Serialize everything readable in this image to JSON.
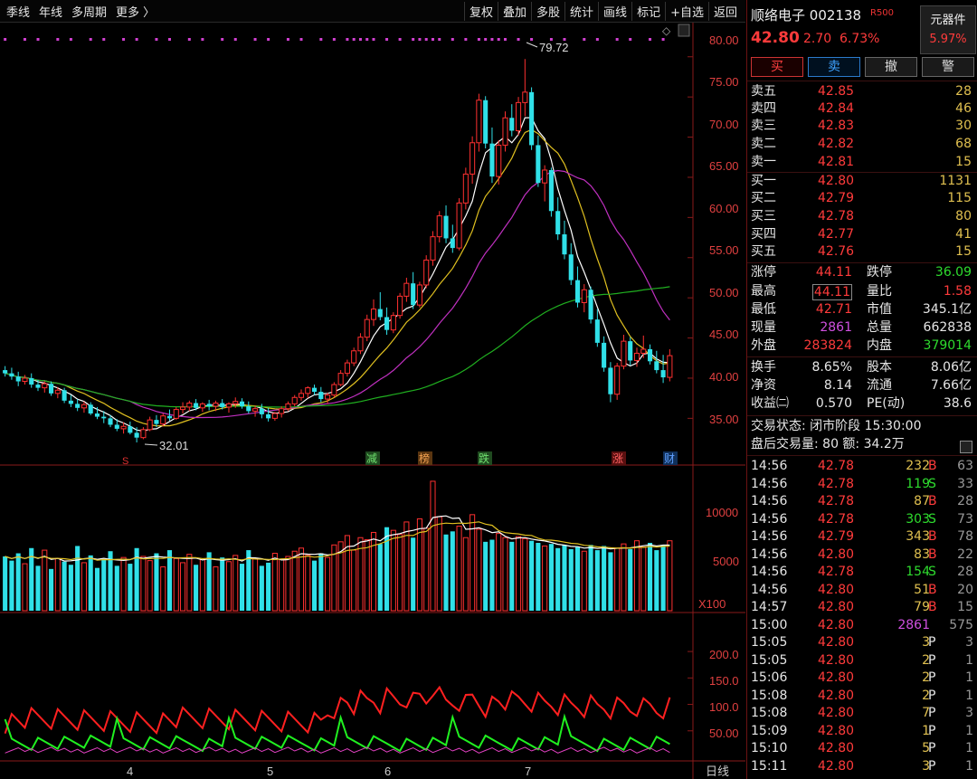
{
  "toolbar": {
    "left": [
      "季线",
      "年线",
      "多周期",
      "更多 〉"
    ],
    "right": [
      "复权",
      "叠加",
      "多股",
      "统计",
      "画线",
      "标记",
      "+自选",
      "返回"
    ]
  },
  "price_axis": [
    "80.00",
    "75.00",
    "70.00",
    "65.00",
    "60.00",
    "55.00",
    "50.00",
    "45.00",
    "40.00",
    "35.00"
  ],
  "volume_axis": [
    "10000",
    "5000"
  ],
  "volume_unit": "X100",
  "indicator_axis": [
    "200.0",
    "150.0",
    "100.0",
    "50.00"
  ],
  "x_axis": [
    "4",
    "5",
    "6",
    "7"
  ],
  "period_label": "日线",
  "annotations": {
    "high": "79.72",
    "low": "32.01",
    "events": [
      {
        "label": "减",
        "color": "#2a8a2a"
      },
      {
        "label": "榜",
        "color": "#b06a20"
      },
      {
        "label": "跌",
        "color": "#2a8a2a"
      },
      {
        "label": "涨",
        "color": "#b02020"
      },
      {
        "label": "财",
        "color": "#2060b0"
      }
    ],
    "marker_s": "S"
  },
  "stock": {
    "name": "顺络电子",
    "code": "002138",
    "badge": "R500",
    "price": "42.80",
    "change": "2.70",
    "change_pct": "6.73%",
    "sector_name": "元器件",
    "sector_pct": "5.97%"
  },
  "buttons": {
    "buy": "买",
    "sell": "卖",
    "cancel": "撤",
    "alert": "警"
  },
  "asks": [
    {
      "label": "卖五",
      "price": "42.85",
      "vol": "28"
    },
    {
      "label": "卖四",
      "price": "42.84",
      "vol": "46"
    },
    {
      "label": "卖三",
      "price": "42.83",
      "vol": "30"
    },
    {
      "label": "卖二",
      "price": "42.82",
      "vol": "68"
    },
    {
      "label": "卖一",
      "price": "42.81",
      "vol": "15"
    }
  ],
  "bids": [
    {
      "label": "买一",
      "price": "42.80",
      "vol": "1131"
    },
    {
      "label": "买二",
      "price": "42.79",
      "vol": "115"
    },
    {
      "label": "买三",
      "price": "42.78",
      "vol": "80"
    },
    {
      "label": "买四",
      "price": "42.77",
      "vol": "41"
    },
    {
      "label": "买五",
      "price": "42.76",
      "vol": "15"
    }
  ],
  "stats1": {
    "limit_up_l": "涨停",
    "limit_up": "44.11",
    "limit_dn_l": "跌停",
    "limit_dn": "36.09",
    "high_l": "最高",
    "high": "44.11",
    "vol_ratio_l": "量比",
    "vol_ratio": "1.58",
    "low_l": "最低",
    "low": "42.71",
    "mcap_l": "市值",
    "mcap": "345.1亿",
    "cur_vol_l": "现量",
    "cur_vol": "2861",
    "total_vol_l": "总量",
    "total_vol": "662838",
    "outer_l": "外盘",
    "outer": "283824",
    "inner_l": "内盘",
    "inner": "379014"
  },
  "stats2": {
    "turnover_l": "换手",
    "turnover": "8.65%",
    "equity_l": "股本",
    "equity": "8.06亿",
    "nav_l": "净资",
    "nav": "8.14",
    "float_l": "流通",
    "float": "7.66亿",
    "eps_l": "收益㈡",
    "eps": "0.570",
    "pe_l": "PE(动)",
    "pe": "38.6"
  },
  "status": {
    "line1": "交易状态: 闭市阶段 15:30:00",
    "line2": "盘后交易量: 80  额: 34.2万"
  },
  "ticks": [
    {
      "t": "14:56",
      "p": "42.78",
      "v": "232",
      "s": "B",
      "n": "63"
    },
    {
      "t": "14:56",
      "p": "42.78",
      "v": "119",
      "s": "S",
      "n": "33"
    },
    {
      "t": "14:56",
      "p": "42.78",
      "v": "87",
      "s": "B",
      "n": "28"
    },
    {
      "t": "14:56",
      "p": "42.78",
      "v": "303",
      "s": "S",
      "n": "73"
    },
    {
      "t": "14:56",
      "p": "42.79",
      "v": "343",
      "s": "B",
      "n": "78"
    },
    {
      "t": "14:56",
      "p": "42.80",
      "v": "83",
      "s": "B",
      "n": "22"
    },
    {
      "t": "14:56",
      "p": "42.78",
      "v": "154",
      "s": "S",
      "n": "28"
    },
    {
      "t": "14:56",
      "p": "42.80",
      "v": "51",
      "s": "B",
      "n": "20"
    },
    {
      "t": "14:57",
      "p": "42.80",
      "v": "79",
      "s": "B",
      "n": "15"
    },
    {
      "t": "15:00",
      "p": "42.80",
      "v": "2861",
      "s": "",
      "n": "575"
    },
    {
      "t": "15:05",
      "p": "42.80",
      "v": "3",
      "s": "P",
      "n": "3"
    },
    {
      "t": "15:05",
      "p": "42.80",
      "v": "2",
      "s": "P",
      "n": "1"
    },
    {
      "t": "15:06",
      "p": "42.80",
      "v": "2",
      "s": "P",
      "n": "1"
    },
    {
      "t": "15:08",
      "p": "42.80",
      "v": "2",
      "s": "P",
      "n": "1"
    },
    {
      "t": "15:08",
      "p": "42.80",
      "v": "7",
      "s": "P",
      "n": "3"
    },
    {
      "t": "15:09",
      "p": "42.80",
      "v": "1",
      "s": "P",
      "n": "1"
    },
    {
      "t": "15:10",
      "p": "42.80",
      "v": "5",
      "s": "P",
      "n": "1"
    },
    {
      "t": "15:11",
      "p": "42.80",
      "v": "3",
      "s": "P",
      "n": "1"
    }
  ],
  "chart_data": {
    "type": "candlestick",
    "ylim": [
      32,
      82
    ],
    "x_ticks": [
      "4",
      "5",
      "6",
      "7"
    ],
    "ohlc": [
      [
        41.0,
        41.5,
        40.2,
        40.6
      ],
      [
        40.6,
        41.3,
        39.8,
        40.2
      ],
      [
        40.2,
        40.8,
        39.0,
        39.6
      ],
      [
        39.6,
        40.4,
        39.2,
        40.0
      ],
      [
        40.0,
        40.6,
        38.8,
        39.2
      ],
      [
        39.2,
        39.8,
        38.4,
        38.8
      ],
      [
        38.8,
        39.6,
        38.2,
        39.3
      ],
      [
        39.3,
        39.6,
        37.8,
        38.1
      ],
      [
        38.1,
        38.9,
        37.5,
        38.5
      ],
      [
        38.5,
        38.8,
        36.9,
        37.2
      ],
      [
        37.2,
        37.9,
        36.4,
        36.8
      ],
      [
        36.8,
        37.4,
        35.9,
        36.3
      ],
      [
        36.3,
        37.1,
        35.7,
        36.7
      ],
      [
        36.7,
        37.0,
        35.4,
        35.6
      ],
      [
        35.6,
        36.4,
        34.9,
        35.2
      ],
      [
        35.2,
        35.9,
        34.4,
        35.0
      ],
      [
        35.0,
        35.4,
        33.9,
        34.2
      ],
      [
        34.2,
        34.9,
        33.4,
        33.7
      ],
      [
        33.7,
        34.5,
        33.1,
        34.0
      ],
      [
        34.0,
        34.6,
        33.0,
        33.2
      ],
      [
        33.2,
        33.9,
        32.0,
        32.6
      ],
      [
        32.6,
        33.9,
        32.4,
        33.6
      ],
      [
        33.6,
        35.2,
        33.4,
        34.8
      ],
      [
        34.8,
        35.4,
        33.9,
        34.3
      ],
      [
        34.3,
        35.6,
        34.0,
        35.3
      ],
      [
        35.3,
        36.1,
        34.7,
        35.0
      ],
      [
        35.0,
        36.4,
        34.8,
        36.1
      ],
      [
        36.1,
        37.0,
        35.6,
        36.4
      ],
      [
        36.4,
        37.2,
        35.9,
        36.9
      ],
      [
        36.9,
        37.4,
        36.0,
        36.3
      ],
      [
        36.3,
        37.0,
        35.8,
        36.8
      ],
      [
        36.8,
        37.3,
        36.0,
        36.5
      ],
      [
        36.5,
        37.2,
        35.9,
        36.9
      ],
      [
        36.9,
        37.4,
        36.1,
        36.4
      ],
      [
        36.4,
        37.0,
        35.7,
        36.8
      ],
      [
        36.8,
        37.6,
        36.3,
        37.1
      ],
      [
        37.1,
        37.5,
        36.2,
        36.5
      ],
      [
        36.5,
        37.1,
        35.6,
        35.9
      ],
      [
        35.9,
        36.6,
        35.2,
        36.2
      ],
      [
        36.2,
        36.8,
        35.0,
        35.5
      ],
      [
        35.5,
        36.3,
        34.6,
        35.0
      ],
      [
        35.0,
        35.8,
        34.7,
        35.6
      ],
      [
        35.6,
        36.5,
        35.1,
        36.2
      ],
      [
        36.2,
        37.1,
        35.9,
        36.8
      ],
      [
        36.8,
        37.9,
        36.5,
        37.6
      ],
      [
        37.6,
        38.6,
        37.2,
        38.1
      ],
      [
        38.1,
        39.0,
        37.5,
        38.8
      ],
      [
        38.8,
        39.2,
        37.9,
        38.3
      ],
      [
        38.3,
        38.9,
        37.0,
        37.4
      ],
      [
        37.4,
        38.2,
        36.8,
        37.9
      ],
      [
        37.9,
        39.5,
        37.6,
        39.2
      ],
      [
        39.2,
        41.0,
        39.0,
        40.6
      ],
      [
        40.6,
        42.3,
        40.2,
        41.9
      ],
      [
        41.9,
        43.8,
        41.5,
        43.4
      ],
      [
        43.4,
        45.6,
        43.0,
        45.1
      ],
      [
        45.1,
        47.9,
        44.6,
        47.3
      ],
      [
        47.3,
        49.8,
        46.5,
        48.6
      ],
      [
        48.6,
        50.7,
        47.2,
        47.6
      ],
      [
        47.6,
        48.8,
        45.4,
        46.0
      ],
      [
        46.0,
        48.2,
        45.6,
        47.8
      ],
      [
        47.8,
        50.6,
        47.4,
        50.2
      ],
      [
        50.2,
        52.5,
        49.5,
        51.8
      ],
      [
        51.8,
        53.2,
        48.6,
        49.1
      ],
      [
        49.1,
        52.0,
        48.8,
        51.6
      ],
      [
        51.6,
        55.3,
        51.2,
        54.7
      ],
      [
        54.7,
        58.3,
        54.0,
        57.6
      ],
      [
        57.6,
        60.8,
        56.9,
        60.2
      ],
      [
        60.2,
        61.5,
        56.8,
        57.4
      ],
      [
        57.4,
        59.1,
        55.6,
        56.2
      ],
      [
        56.2,
        62.4,
        55.9,
        61.8
      ],
      [
        61.8,
        66.2,
        61.0,
        65.4
      ],
      [
        65.4,
        70.1,
        64.2,
        69.3
      ],
      [
        69.3,
        75.4,
        68.2,
        74.6
      ],
      [
        74.6,
        75.1,
        68.6,
        69.2
      ],
      [
        69.2,
        71.2,
        64.3,
        65.1
      ],
      [
        65.1,
        69.6,
        64.1,
        69.0
      ],
      [
        69.0,
        73.2,
        68.2,
        72.4
      ],
      [
        72.4,
        74.1,
        70.1,
        70.8
      ],
      [
        70.8,
        75.0,
        70.2,
        74.3
      ],
      [
        74.3,
        79.72,
        72.6,
        75.6
      ],
      [
        75.6,
        76.2,
        68.4,
        69.0
      ],
      [
        69.0,
        70.2,
        63.8,
        64.3
      ],
      [
        64.3,
        66.5,
        62.0,
        65.9
      ],
      [
        65.9,
        66.2,
        60.1,
        60.8
      ],
      [
        60.8,
        62.5,
        57.2,
        57.9
      ],
      [
        57.9,
        59.6,
        54.8,
        55.4
      ],
      [
        55.4,
        56.8,
        51.6,
        52.2
      ],
      [
        52.2,
        53.9,
        48.8,
        49.4
      ],
      [
        49.4,
        51.7,
        48.2,
        51.0
      ],
      [
        51.0,
        51.4,
        46.8,
        47.3
      ],
      [
        47.3,
        48.6,
        43.9,
        44.4
      ],
      [
        44.4,
        45.2,
        40.8,
        41.3
      ],
      [
        41.3,
        42.0,
        37.0,
        38.0
      ],
      [
        38.0,
        41.9,
        37.3,
        41.5
      ],
      [
        41.5,
        45.4,
        41.1,
        44.6
      ],
      [
        44.6,
        45.1,
        41.6,
        42.2
      ],
      [
        42.2,
        43.8,
        41.4,
        43.1
      ],
      [
        43.1,
        45.3,
        42.5,
        43.6
      ],
      [
        43.6,
        44.2,
        41.7,
        42.1
      ],
      [
        42.1,
        43.4,
        40.6,
        41.0
      ],
      [
        41.0,
        42.9,
        39.4,
        40.1
      ],
      [
        40.1,
        43.6,
        39.6,
        42.8
      ]
    ],
    "ma_series": [
      {
        "color": "#ffffff",
        "period": 5
      },
      {
        "color": "#e0c020",
        "period": 10
      },
      {
        "color": "#c030c0",
        "period": 20
      },
      {
        "color": "#20b020",
        "period": 60
      }
    ],
    "volume": [
      52,
      48,
      55,
      45,
      60,
      43,
      58,
      40,
      50,
      47,
      44,
      62,
      46,
      53,
      41,
      49,
      57,
      43,
      51,
      45,
      60,
      52,
      48,
      55,
      42,
      58,
      50,
      46,
      54,
      44,
      49,
      56,
      42,
      51,
      47,
      53,
      45,
      58,
      50,
      43,
      46,
      55,
      49,
      52,
      57,
      60,
      53,
      48,
      55,
      51,
      63,
      66,
      72,
      58,
      70,
      68,
      75,
      64,
      80,
      77,
      73,
      85,
      70,
      88,
      79,
      124,
      90,
      73,
      76,
      81,
      70,
      92,
      78,
      66,
      68,
      74,
      70,
      66,
      71,
      69,
      67,
      65,
      62,
      64,
      60,
      63,
      59,
      61,
      57,
      63,
      58,
      62,
      56,
      60,
      64,
      59,
      67,
      61,
      65,
      58,
      63,
      67
    ],
    "volume_ylim": [
      0,
      13000
    ],
    "indicator_ylim": [
      0,
      260
    ],
    "indicator_ticks": [
      50,
      100,
      150,
      200
    ]
  }
}
